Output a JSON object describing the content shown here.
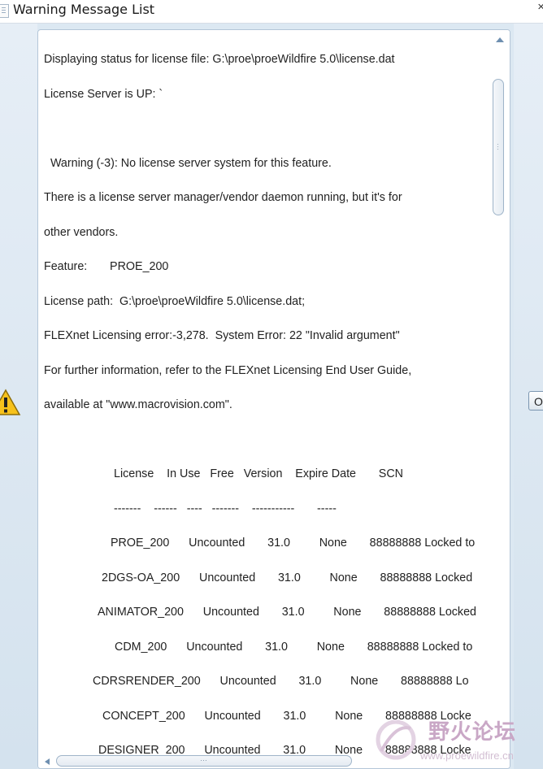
{
  "window": {
    "title": "Warning Message List",
    "close_glyph": "×",
    "icon": "document-icon"
  },
  "left_pane": {
    "icon": "warning-triangle-icon"
  },
  "buttons": {
    "ok_label": "O"
  },
  "message": {
    "lines": [
      "Displaying status for license file: G:\\proe\\proeWildfire 5.0\\license.dat",
      "License Server is UP: `",
      "",
      "  Warning (-3): No license server system for this feature.",
      "There is a license server manager/vendor daemon running, but it's for",
      "other vendors.",
      "Feature:       PROE_200",
      "License path:  G:\\proe\\proeWildfire 5.0\\license.dat;",
      "FLEXnet Licensing error:-3,278.  System Error: 22 \"Invalid argument\"",
      "For further information, refer to the FLEXnet Licensing End User Guide,",
      "available at \"www.macrovision.com\".",
      "",
      "License    In Use   Free   Version    Expire Date       SCN",
      "-------    ------   ----   -------    -----------       -----",
      "PROE_200      Uncounted       31.0         None       88888888 Locked to",
      "2DGS-OA_200      Uncounted       31.0         None       88888888 Locked",
      "ANIMATOR_200      Uncounted       31.0         None       88888888 Locked",
      "CDM_200      Uncounted       31.0         None       88888888 Locked to",
      "CDRSRENDER_200      Uncounted       31.0         None       88888888 Lo",
      "CONCEPT_200      Uncounted       31.0         None       88888888 Locke",
      "DESIGNER_200      Uncounted       31.0         None       88888888 Locke"
    ]
  },
  "scrollbars": {
    "vertical_up": "scroll-up-arrow-icon",
    "horizontal_left": "scroll-left-arrow-icon",
    "horizontal_grip": "…"
  },
  "watermark": {
    "text_cn": "野火论坛",
    "url": "www.proewildfire.cn",
    "icon": "wildfire-logo-icon"
  }
}
